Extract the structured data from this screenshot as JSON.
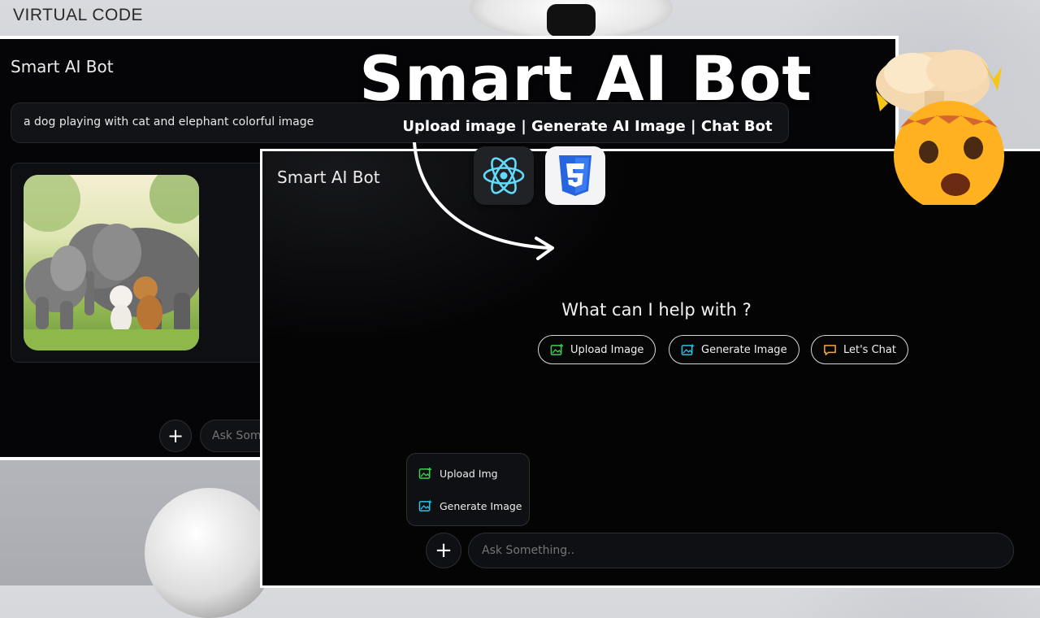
{
  "channel": {
    "name": "VIRTUAL CODE"
  },
  "headline": {
    "title": "Smart AI Bot",
    "subtitle": "Upload image | Generate AI Image | Chat Bot"
  },
  "back_window": {
    "title": "Smart AI Bot",
    "prompt": "a dog playing with cat and elephant colorful image",
    "input_placeholder": "Ask Something.."
  },
  "front_window": {
    "title": "Smart AI Bot",
    "heading": "What can I help with ?",
    "actions": [
      {
        "label": "Upload Image",
        "icon": "image-upload-icon"
      },
      {
        "label": "Generate Image",
        "icon": "image-sparkle-icon"
      },
      {
        "label": "Let's Chat",
        "icon": "chat-bubble-icon"
      }
    ],
    "menu": [
      {
        "label": "Upload Img",
        "icon": "image-upload-icon"
      },
      {
        "label": "Generate Image",
        "icon": "image-sparkle-icon"
      }
    ],
    "input_placeholder": "Ask Something.."
  },
  "tech_logos": [
    "react-logo",
    "css3-logo"
  ],
  "colors": {
    "upload_icon": "#3ccf4e",
    "generate_icon": "#29c3e6",
    "chat_icon": "#f2a93b",
    "window_bg": "#040405"
  }
}
